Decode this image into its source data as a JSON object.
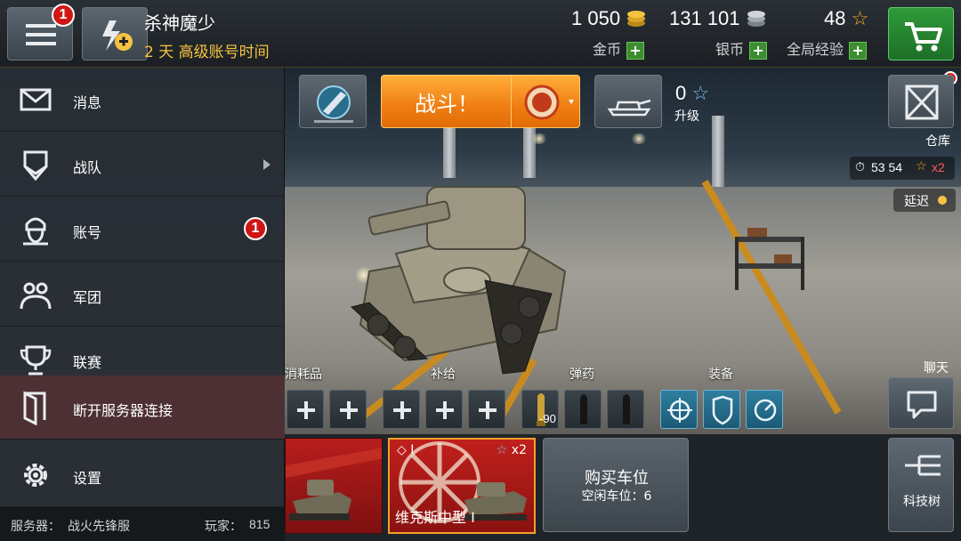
{
  "header": {
    "menu_badge": "1",
    "player_name": "杀神魔少",
    "premium_time": "2 天 高级账号时间",
    "gold": {
      "value": "1 050",
      "label": "金币"
    },
    "silver": {
      "value": "131 101",
      "label": "银币"
    },
    "free_xp": {
      "value": "48",
      "label": "全局经验"
    },
    "plus_symbol": "+"
  },
  "side_menu": {
    "items": [
      {
        "label": "消息",
        "icon": "envelope-icon"
      },
      {
        "label": "战队",
        "icon": "chevron-shield-icon"
      },
      {
        "label": "账号",
        "icon": "commander-icon",
        "badge": "1"
      },
      {
        "label": "军团",
        "icon": "clan-icon"
      },
      {
        "label": "联赛",
        "icon": "trophy-icon"
      },
      {
        "label": "断开服务器连接",
        "icon": "door-exit-icon"
      },
      {
        "label": "设置",
        "icon": "gear-icon"
      }
    ],
    "server_label": "服务器：",
    "server_name": "战火先锋服",
    "players_label": "玩家：",
    "players_count": "815"
  },
  "actions": {
    "battle_label": "战斗！",
    "upgrade_count": "0",
    "upgrade_label": "升级",
    "depot_label": "仓库",
    "timer": "53 54",
    "xp_multiplier": "x2",
    "ping_label": "延迟"
  },
  "loadout": {
    "consumables_label": "消耗品",
    "provisions_label": "补给",
    "ammo_label": "弹药",
    "equipment_label": "装备",
    "ammo_count": "90"
  },
  "chat_label": "聊天",
  "carousel": {
    "selected_tank": {
      "name": "维克斯中型 I",
      "tier": "I",
      "xp_bonus": "x2"
    },
    "buy_slot_title": "购买车位",
    "free_slots_label": "空闲车位：",
    "free_slots_count": "6"
  },
  "tech_tree_label": "科技树",
  "colors": {
    "accent_orange": "#f07d12",
    "gold": "#f5c342",
    "shop_green": "#2f9a3a",
    "badge_red": "#d01515",
    "equip_blue": "#2f7ea0"
  }
}
